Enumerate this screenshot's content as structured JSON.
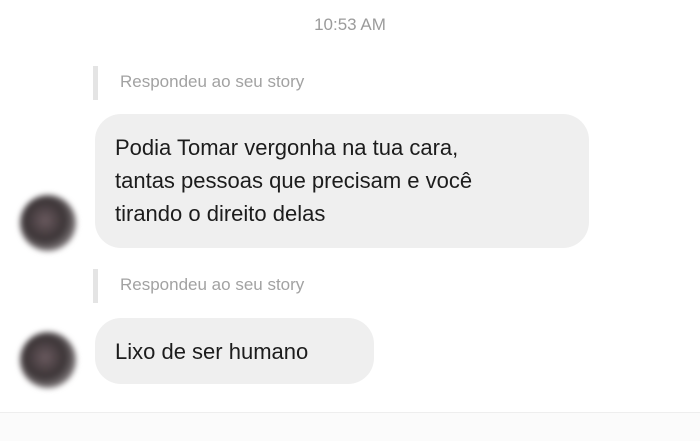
{
  "conversation": {
    "timestamp": "10:53 AM",
    "messages": [
      {
        "reply_context": "Respondeu ao seu story",
        "lines": [
          "Podia Tomar vergonha na tua cara,",
          "tantas pessoas que precisam e você",
          "tirando o direito delas"
        ]
      },
      {
        "reply_context": "Respondeu ao seu story",
        "lines": [
          "Lixo de ser humano"
        ]
      }
    ]
  }
}
